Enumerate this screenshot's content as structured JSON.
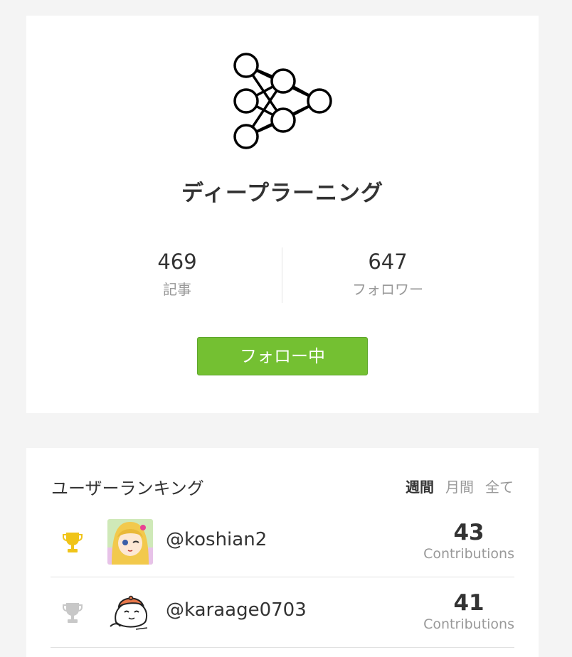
{
  "tag": {
    "name": "ディープラーニング",
    "logo_icon": "neural-network-icon",
    "stats": {
      "articles_value": "469",
      "articles_label": "記事",
      "followers_value": "647",
      "followers_label": "フォロワー"
    },
    "follow_button_label": "フォロー中",
    "follow_button_color": "#74c032"
  },
  "ranking": {
    "title": "ユーザーランキング",
    "tabs": [
      {
        "label": "週間",
        "active": true
      },
      {
        "label": "月間",
        "active": false
      },
      {
        "label": "全て",
        "active": false
      }
    ],
    "rows": [
      {
        "trophy_icon": "gold-trophy-icon",
        "trophy_color": "#f0c419",
        "username": "@koshian2",
        "contributions": "43",
        "contributions_label": "Contributions"
      },
      {
        "trophy_icon": "silver-trophy-icon",
        "trophy_color": "#c8c8c8",
        "username": "@karaage0703",
        "contributions": "41",
        "contributions_label": "Contributions"
      }
    ]
  }
}
